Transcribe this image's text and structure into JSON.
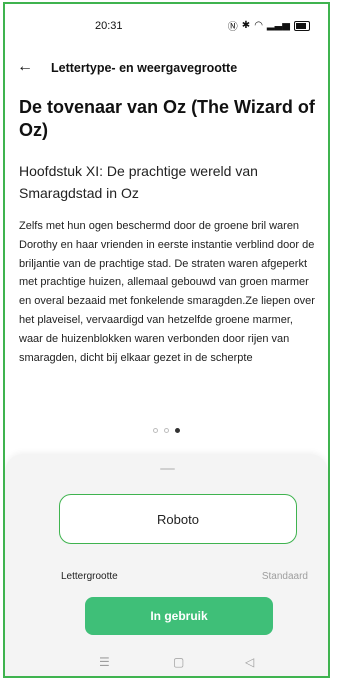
{
  "status_bar": {
    "time": "20:31",
    "icons": [
      "nfc-icon",
      "bluetooth-icon",
      "wifi-icon",
      "signal-icon",
      "battery-icon"
    ]
  },
  "header": {
    "back_icon": "←",
    "title": "Lettertype- en weergavegrootte"
  },
  "preview": {
    "book_title": "De tovenaar van Oz (The Wizard of Oz)",
    "chapter": "Hoofdstuk XI: De prachtige wereld van Smaragdstad in Oz",
    "body": "Zelfs met hun ogen beschermd door de groene bril waren Dorothy en haar vrienden in eerste instantie verblind door de briljantie van de prachtige stad. De straten waren afgeperkt met prachtige huizen, allemaal gebouwd van groen marmer en overal bezaaid met fonkelende smaragden.Ze liepen over het plaveisel, vervaardigd van hetzelfde groene marmer, waar de huizenblokken waren verbonden door rijen van smaragden, dicht bij elkaar gezet in de scherpte",
    "page_dots": 3,
    "active_dot": 2
  },
  "sheet": {
    "font_name": "Roboto",
    "font_size_label": "Lettergrootte",
    "font_size_value": "Standaard",
    "use_button": "In gebruik"
  },
  "nav": {
    "menu": "☰",
    "home": "▢",
    "back": "◁"
  },
  "colors": {
    "accent": "#3fbf78",
    "frame": "#3fb34f"
  }
}
